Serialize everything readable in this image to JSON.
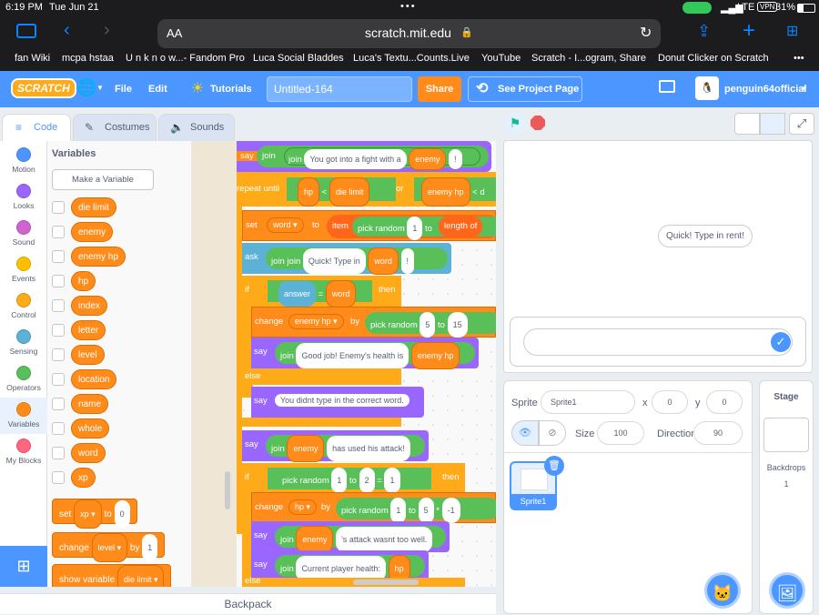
{
  "status": {
    "time": "6:19 PM",
    "date": "Tue Jun 21",
    "network": "LTE",
    "vpn": "VPN",
    "battery": "31%"
  },
  "browser": {
    "aa_label": "AA",
    "url": "scratch.mit.edu",
    "bookmarks": [
      "fan Wiki",
      "mcpa hstaa",
      "U n k n o w...- Fandom Pro",
      "Luca Social Bladdes",
      "Luca's Textu...Counts.Live",
      "YouTube",
      "Scratch - I...ogram, Share",
      "Donut Clicker on Scratch"
    ],
    "more_label": "•••"
  },
  "menu": {
    "logo": "SCRATCH",
    "file": "File",
    "edit": "Edit",
    "tutorials": "Tutorials",
    "project_title": "Untitled-164",
    "share": "Share",
    "see_project": "See Project Page",
    "username": "penguin64official"
  },
  "tabs": {
    "code": "Code",
    "costumes": "Costumes",
    "sounds": "Sounds"
  },
  "categories": [
    {
      "label": "Motion",
      "color": "#4c97ff"
    },
    {
      "label": "Looks",
      "color": "#9966ff"
    },
    {
      "label": "Sound",
      "color": "#cf63cf"
    },
    {
      "label": "Events",
      "color": "#ffbf00"
    },
    {
      "label": "Control",
      "color": "#ffab19"
    },
    {
      "label": "Sensing",
      "color": "#5cb1d6"
    },
    {
      "label": "Operators",
      "color": "#59c059"
    },
    {
      "label": "Variables",
      "color": "#ff8c1a"
    },
    {
      "label": "My Blocks",
      "color": "#ff6680"
    }
  ],
  "palette": {
    "heading": "Variables",
    "make_variable": "Make a Variable",
    "variables": [
      "die limit",
      "enemy",
      "enemy hp",
      "hp",
      "index",
      "letter",
      "level",
      "location",
      "name",
      "whole",
      "word",
      "xp"
    ],
    "set_block": {
      "verb": "set",
      "var": "xp",
      "to": "to",
      "value": "0"
    },
    "change_block": {
      "verb": "change",
      "var": "level",
      "by": "by",
      "value": "1"
    },
    "show_block": {
      "verb": "show variable",
      "var": "die limit"
    }
  },
  "script": {
    "say1": {
      "say": "say",
      "join": "join",
      "text": "You got into a fight with a",
      "var": "enemy",
      "end": "!"
    },
    "repeat": {
      "label": "repeat until",
      "a": "hp",
      "lt": "<",
      "b": "die limit",
      "or": "or",
      "c": "enemy hp",
      "lt2": "<",
      "d": "d"
    },
    "setword": {
      "set": "set",
      "var": "word",
      "to": "to",
      "item": "item",
      "pick": "pick random",
      "n": "1",
      "to2": "to",
      "length": "length of"
    },
    "ask": {
      "ask": "ask",
      "join": "join",
      "text": "Quick! Type in",
      "var": "word",
      "end": "!"
    },
    "if1": {
      "if": "if",
      "a": "answer",
      "eq": "=",
      "b": "word",
      "then": "then"
    },
    "change1": {
      "change": "change",
      "var": "enemy hp",
      "by": "by",
      "pick": "pick random",
      "a": "5",
      "to": "to",
      "b": "15"
    },
    "say2": {
      "say": "say",
      "join": "join",
      "text": "Good job! Enemy's health is",
      "var": "enemy hp"
    },
    "else1": "else",
    "say3": {
      "say": "say",
      "text": "You didnt type in the correct word."
    },
    "say4": {
      "say": "say",
      "join": "join",
      "var": "enemy",
      "text": "has used his attack!"
    },
    "if2": {
      "if": "if",
      "pick": "pick random",
      "a": "1",
      "to": "to",
      "b": "2",
      "eq": "=",
      "c": "1",
      "then": "then"
    },
    "change2": {
      "change": "change",
      "var": "hp",
      "by": "by",
      "pick": "pick random",
      "a": "1",
      "to": "to",
      "b": "5",
      "mul": "*",
      "c": "-1"
    },
    "say5": {
      "say": "say",
      "join": "join",
      "var": "enemy",
      "text": "'s attack wasnt too well."
    },
    "say6": {
      "say": "say",
      "join": "join",
      "text": "Current player health:",
      "var": "hp"
    },
    "else2": "else"
  },
  "backpack": "Backpack",
  "stage": {
    "bubble": "Quick! Type in rent!"
  },
  "sprite": {
    "sprite_label": "Sprite",
    "name": "Sprite1",
    "x_label": "x",
    "x": "0",
    "y_label": "y",
    "y": "0",
    "size_label": "Size",
    "size": "100",
    "direction_label": "Direction",
    "direction": "90",
    "thumb_name": "Sprite1"
  },
  "stage_panel": {
    "title": "Stage",
    "backdrops_label": "Backdrops",
    "backdrops_count": "1"
  }
}
